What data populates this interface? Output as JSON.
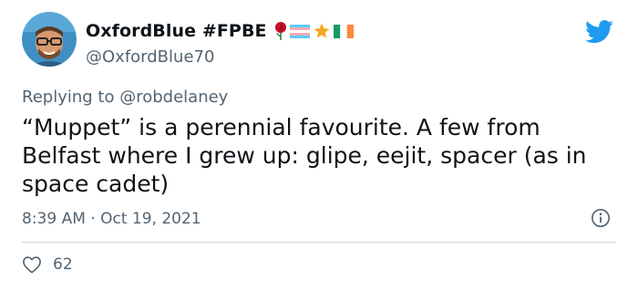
{
  "tweet": {
    "display_name": "OxfordBlue #FPBE",
    "handle": "@OxfordBlue70",
    "name_emoji_icons": [
      "rose-icon",
      "trans-flag-icon",
      "star-icon",
      "ireland-flag-icon"
    ],
    "reply_prefix": "Replying to",
    "reply_to": "@robdelaney",
    "text": "“Muppet” is a perennial favourite. A few from Belfast where I grew up: glipe, eejit, spacer (as in space cadet)",
    "time": "8:39 AM",
    "separator": "·",
    "date": "Oct 19, 2021",
    "likes": "62"
  },
  "colors": {
    "twitter_blue": "#1d9bf0",
    "muted_text": "#536471",
    "divider": "#cfd9de"
  }
}
